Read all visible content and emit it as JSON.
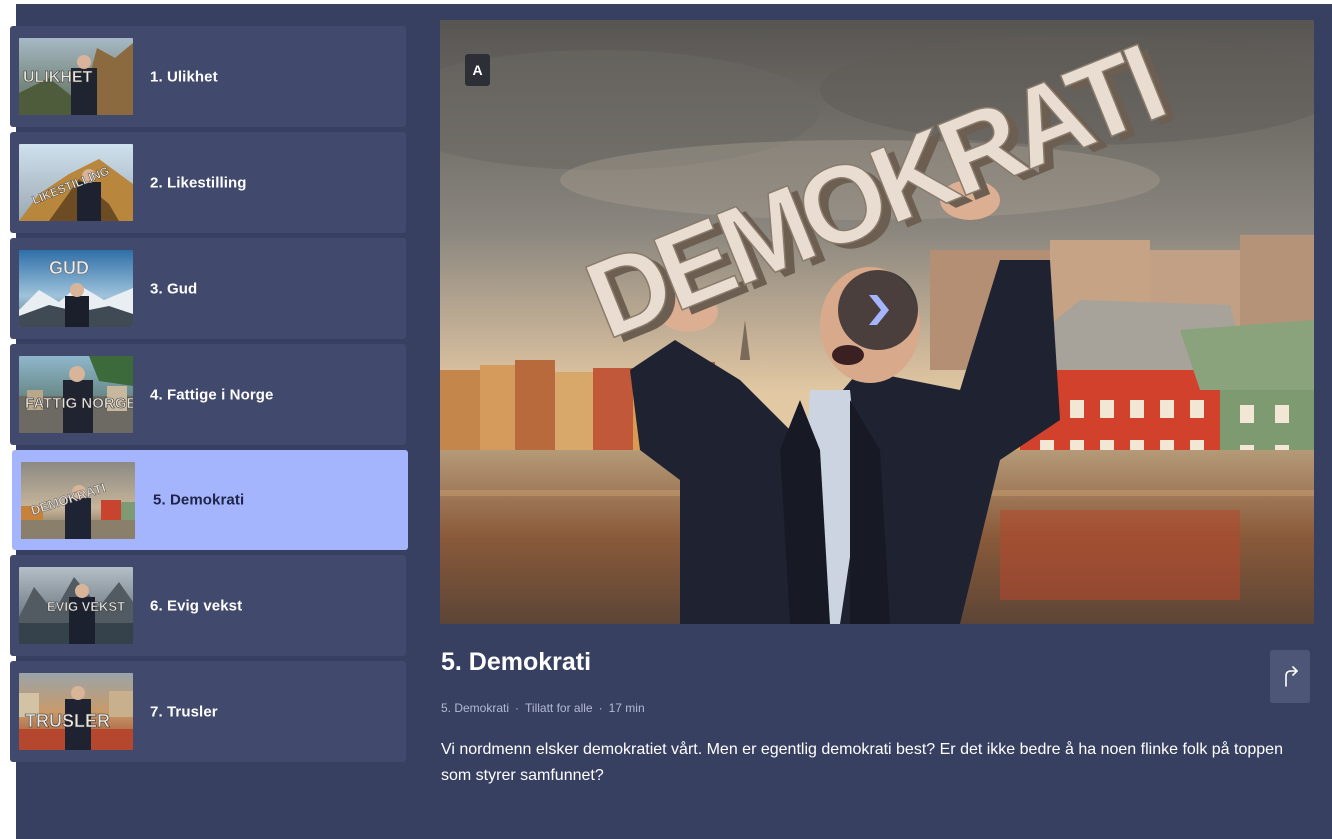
{
  "colors": {
    "app_background": "#384062",
    "episode_card": "#41496c",
    "episode_active": "#a4b4fd",
    "text_primary": "#ffffff",
    "text_meta": "#b3b9d4"
  },
  "episodes": [
    {
      "label": "1. Ulikhet",
      "thumb_text": "ULIKHET",
      "active": false
    },
    {
      "label": "2. Likestilling",
      "thumb_text": "LIKESTILLING",
      "active": false
    },
    {
      "label": "3. Gud",
      "thumb_text": "GUD",
      "active": false
    },
    {
      "label": "4. Fattige i Norge",
      "thumb_text": "FATTIG NORGE",
      "active": false
    },
    {
      "label": "5. Demokrati",
      "thumb_text": "DEMOKRATI",
      "active": true
    },
    {
      "label": "6. Evig vekst",
      "thumb_text": "EVIG VEKST",
      "active": false
    },
    {
      "label": "7. Trusler",
      "thumb_text": "TRUSLER",
      "active": false
    }
  ],
  "player": {
    "rating_badge": "A",
    "poster_text": "DEMOKRATI",
    "play_icon": "chevron-right-icon"
  },
  "details": {
    "title": "5. Demokrati",
    "meta": {
      "episode": "5. Demokrati",
      "age_rating": "Tillatt for alle",
      "duration": "17 min"
    },
    "description": "Vi nordmenn elsker demokratiet vårt. Men er egentlig demokrati best? Er det ikke bedre å ha noen flinke folk på toppen som styrer samfunnet?",
    "share_icon": "share-arrow-icon"
  }
}
